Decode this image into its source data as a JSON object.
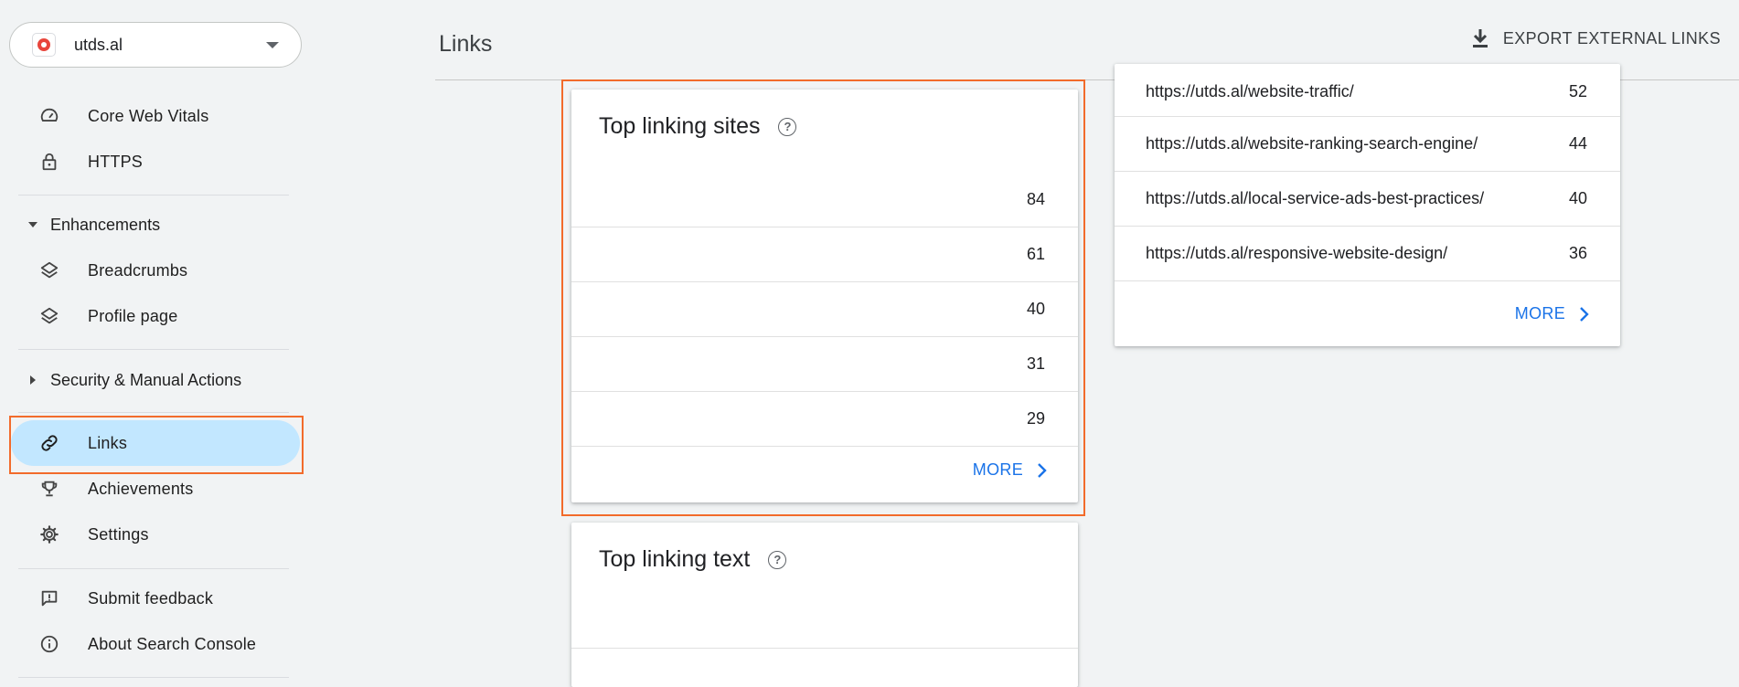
{
  "property": {
    "name": "utds.al"
  },
  "sidebar": {
    "items_top": [
      {
        "label": "Core Web Vitals",
        "icon": "speedometer-icon"
      },
      {
        "label": "HTTPS",
        "icon": "lock-icon"
      }
    ],
    "enhancements_label": "Enhancements",
    "enhancements": [
      {
        "label": "Breadcrumbs",
        "icon": "layers-icon"
      },
      {
        "label": "Profile page",
        "icon": "layers-icon"
      }
    ],
    "security_label": "Security & Manual Actions",
    "items_mid": [
      {
        "label": "Links",
        "icon": "link-icon",
        "active": true
      },
      {
        "label": "Achievements",
        "icon": "trophy-icon"
      },
      {
        "label": "Settings",
        "icon": "gear-icon"
      }
    ],
    "items_bottom": [
      {
        "label": "Submit feedback",
        "icon": "feedback-icon"
      },
      {
        "label": "About Search Console",
        "icon": "info-icon"
      }
    ]
  },
  "header": {
    "title": "Links",
    "export_label": "EXPORT EXTERNAL LINKS"
  },
  "top_linking_sites": {
    "title": "Top linking sites",
    "rows": [
      {
        "site": "",
        "count": "84"
      },
      {
        "site": "",
        "count": "61"
      },
      {
        "site": "",
        "count": "40"
      },
      {
        "site": "",
        "count": "31"
      },
      {
        "site": "",
        "count": "29"
      }
    ],
    "more_label": "MORE"
  },
  "top_linked_pages": {
    "rows": [
      {
        "url": "https://utds.al/website-traffic/",
        "count": "52"
      },
      {
        "url": "https://utds.al/website-ranking-search-engine/",
        "count": "44"
      },
      {
        "url": "https://utds.al/local-service-ads-best-practices/",
        "count": "40"
      },
      {
        "url": "https://utds.al/responsive-website-design/",
        "count": "36"
      }
    ],
    "more_label": "MORE"
  },
  "top_linking_text": {
    "title": "Top linking text"
  },
  "colors": {
    "accent": "#1a73e8",
    "active_nav": "#c2e7ff",
    "highlight": "#f26b2b"
  }
}
